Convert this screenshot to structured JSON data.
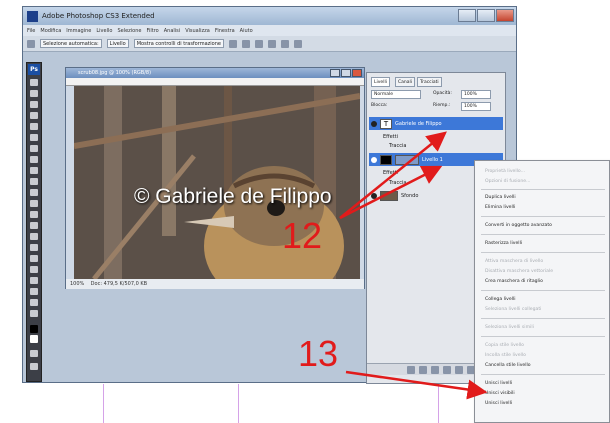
{
  "app": {
    "title": "Adobe Photoshop CS3 Extended",
    "menu": [
      "File",
      "Modifica",
      "Immagine",
      "Livello",
      "Selezione",
      "Filtro",
      "Analisi",
      "Visualizza",
      "Finestra",
      "Aiuto"
    ],
    "options": {
      "auto_select_label": "Selezione automatica:",
      "auto_select_value": "Livello",
      "show_transform_label": "Mostra controlli di trasformazione"
    }
  },
  "document": {
    "title": "scrub08.jpg @ 100% (RGB/8)",
    "zoom": "100%",
    "doc_size": "Doc: 479,5 K/507,0 KB",
    "watermark": "© Gabriele de Filippo"
  },
  "layers_panel": {
    "tabs": [
      "Livelli",
      "Canali",
      "Tracciati"
    ],
    "blend_mode": "Normale",
    "opacity_label": "Opacità:",
    "opacity_value": "100%",
    "lock_label": "Blocca:",
    "fill_label": "Riemp.:",
    "fill_value": "100%",
    "layers": [
      {
        "name": "Gabriele de Filippo",
        "type": "text",
        "selected": true
      },
      {
        "name": "Effetti",
        "type": "effect",
        "selected": false
      },
      {
        "name": "Traccia",
        "type": "effect",
        "selected": false
      },
      {
        "name": "Livello 1",
        "type": "fill",
        "selected": true
      },
      {
        "name": "Effetti",
        "type": "effect",
        "selected": false
      },
      {
        "name": "Traccia",
        "type": "effect",
        "selected": false
      },
      {
        "name": "Sfondo",
        "type": "image",
        "selected": false
      }
    ]
  },
  "context_menu": {
    "items": [
      {
        "label": "Proprietà livello...",
        "enabled": false
      },
      {
        "label": "Opzioni di fusione...",
        "enabled": false
      },
      {
        "label": "Duplica livelli",
        "enabled": true
      },
      {
        "label": "Elimina livelli",
        "enabled": true
      },
      {
        "label": "Converti in oggetto avanzato",
        "enabled": true
      },
      {
        "label": "Rasterizza livelli",
        "enabled": true
      },
      {
        "label": "Attiva maschera di livello",
        "enabled": false
      },
      {
        "label": "Disattiva maschera vettoriale",
        "enabled": false
      },
      {
        "label": "Crea maschera di ritaglio",
        "enabled": true
      },
      {
        "label": "Collega livelli",
        "enabled": true
      },
      {
        "label": "Seleziona livelli collegati",
        "enabled": false
      },
      {
        "label": "Seleziona livelli simili",
        "enabled": false
      },
      {
        "label": "Copia stile livello",
        "enabled": false
      },
      {
        "label": "Incolla stile livello",
        "enabled": false
      },
      {
        "label": "Cancella stile livello",
        "enabled": true
      },
      {
        "label": "Unisci livelli",
        "enabled": true
      },
      {
        "label": "Unisci visibili",
        "enabled": true
      },
      {
        "label": "Unisci livelli",
        "enabled": true
      }
    ]
  },
  "annotations": {
    "step_a": "12",
    "step_b": "13",
    "color": "#e11b1b"
  }
}
